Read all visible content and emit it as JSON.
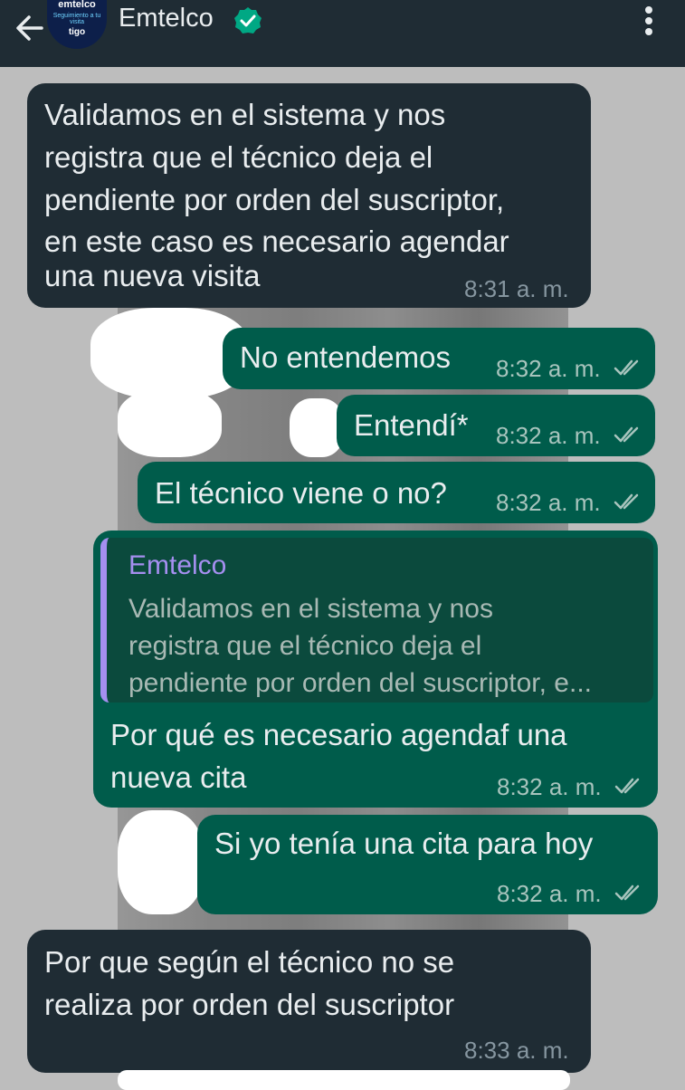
{
  "header": {
    "title": "Emtelco",
    "avatar_line1": "emtelco",
    "avatar_line2": "Seguimiento a tu visita",
    "avatar_line3": "tigo"
  },
  "messages": [
    {
      "direction": "in",
      "lines": [
        "Validamos en el sistema y nos",
        "registra que el técnico deja el",
        "pendiente por orden del suscriptor,",
        "en este caso es necesario agendar",
        "una nueva visita"
      ],
      "time": "8:31 a. m."
    },
    {
      "direction": "out",
      "text": "No entendemos",
      "time": "8:32 a. m."
    },
    {
      "direction": "out",
      "text": "Entendí*",
      "time": "8:32 a. m."
    },
    {
      "direction": "out",
      "text": "El técnico viene o no?",
      "time": "8:32 a. m."
    },
    {
      "direction": "out",
      "quote": {
        "author": "Emtelco",
        "lines": [
          "Validamos en el sistema y nos",
          "registra que el técnico deja el",
          "pendiente por orden del suscriptor, e..."
        ]
      },
      "lines": [
        "Por qué es necesario agendaf una",
        "nueva cita"
      ],
      "time": "8:32 a. m."
    },
    {
      "direction": "out",
      "text": "Si yo tenía una cita para hoy",
      "time": "8:32 a. m."
    },
    {
      "direction": "in",
      "lines": [
        "Por que según el técnico no se",
        "realiza por orden del suscriptor"
      ],
      "time": "8:33 a. m."
    }
  ],
  "colors": {
    "header_bg": "#1f2c34",
    "incoming_bubble": "#1f2c34",
    "outgoing_bubble": "#005c4b",
    "quote_accent": "#a58ff0",
    "verified": "#00a884"
  }
}
